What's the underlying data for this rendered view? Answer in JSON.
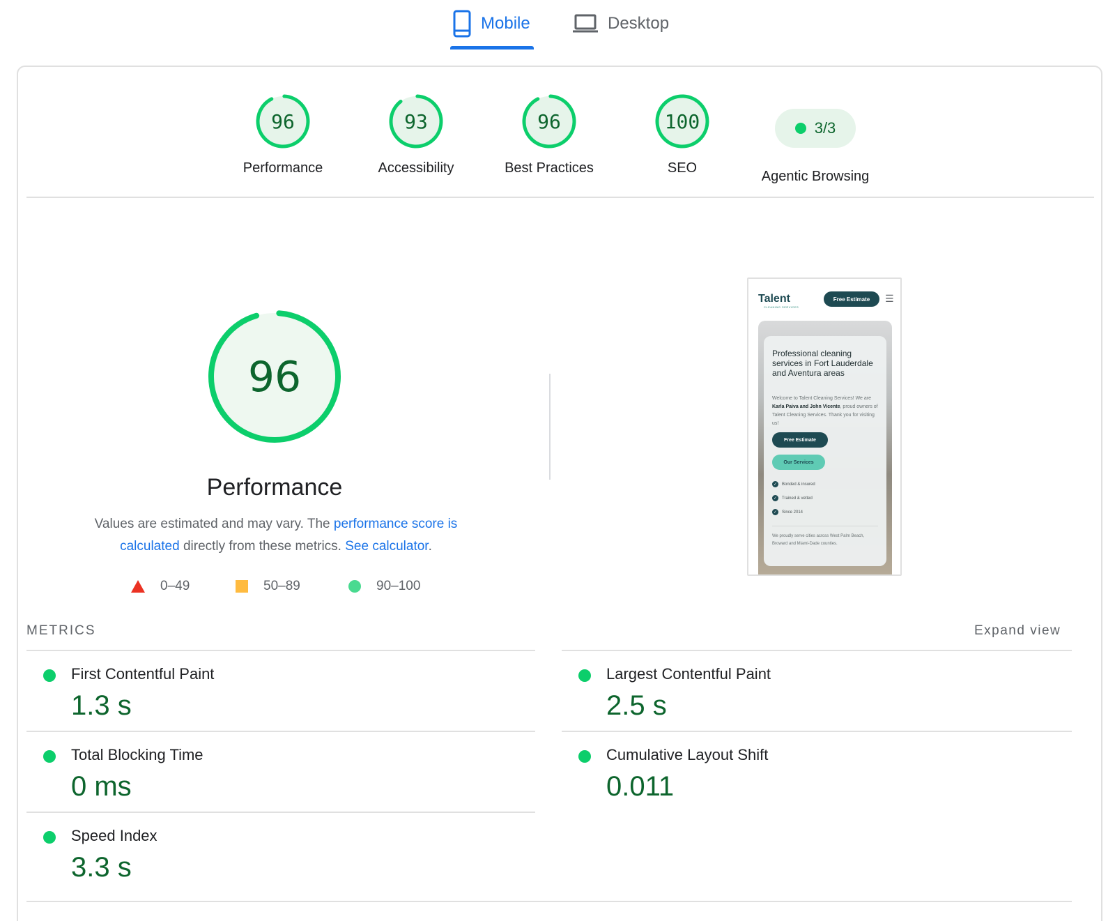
{
  "tabs": [
    {
      "label": "Mobile",
      "active": true,
      "icon": "phone-icon"
    },
    {
      "label": "Desktop",
      "active": false,
      "icon": "laptop-icon"
    }
  ],
  "categories": [
    {
      "label": "Performance",
      "score": 96
    },
    {
      "label": "Accessibility",
      "score": 93
    },
    {
      "label": "Best Practices",
      "score": 96
    },
    {
      "label": "SEO",
      "score": 100
    }
  ],
  "agentic": {
    "label": "Agentic Browsing",
    "value": "3/3"
  },
  "performance": {
    "score": 96,
    "title": "Performance",
    "desc_pre": "Values are estimated and may vary. The ",
    "desc_link1": "performance score is calculated",
    "desc_mid": " directly from these metrics. ",
    "desc_link2": "See calculator",
    "desc_post": "."
  },
  "legend": {
    "fail": "0–49",
    "average": "50–89",
    "pass": "90–100"
  },
  "colors": {
    "pass": "#0cce6b",
    "pass_text": "#0d652d",
    "pass_bg": "#e6f4ea",
    "average": "#ffa400",
    "fail": "#eb3223",
    "accent": "#1a73e8"
  },
  "metrics_header": {
    "title": "METRICS",
    "expand": "Expand view"
  },
  "metrics": [
    {
      "name": "First Contentful Paint",
      "value": "1.3 s"
    },
    {
      "name": "Largest Contentful Paint",
      "value": "2.5 s"
    },
    {
      "name": "Total Blocking Time",
      "value": "0 ms"
    },
    {
      "name": "Cumulative Layout Shift",
      "value": "0.011"
    },
    {
      "name": "Speed Index",
      "value": "3.3 s"
    }
  ],
  "thumbnail": {
    "logo": "Talent",
    "logo_sub": "CLEANING SERVICES",
    "top_button": "Free Estimate",
    "headline": "Professional cleaning services in Fort Lauderdale and Aventura areas",
    "body_pre": "Welcome to Talent Cleaning Services! We are ",
    "body_bold": "Karla Paiva and John Vicente",
    "body_post": ", proud owners of Talent Cleaning Services. Thank you for visiting us!",
    "button1": "Free Estimate",
    "button2": "Our Services",
    "checks": [
      "Bonded & insured",
      "Trained & vetted",
      "Since 2014"
    ],
    "footer": "We proudly serve cities across West Palm Beach, Broward and Miami-Dade counties."
  }
}
